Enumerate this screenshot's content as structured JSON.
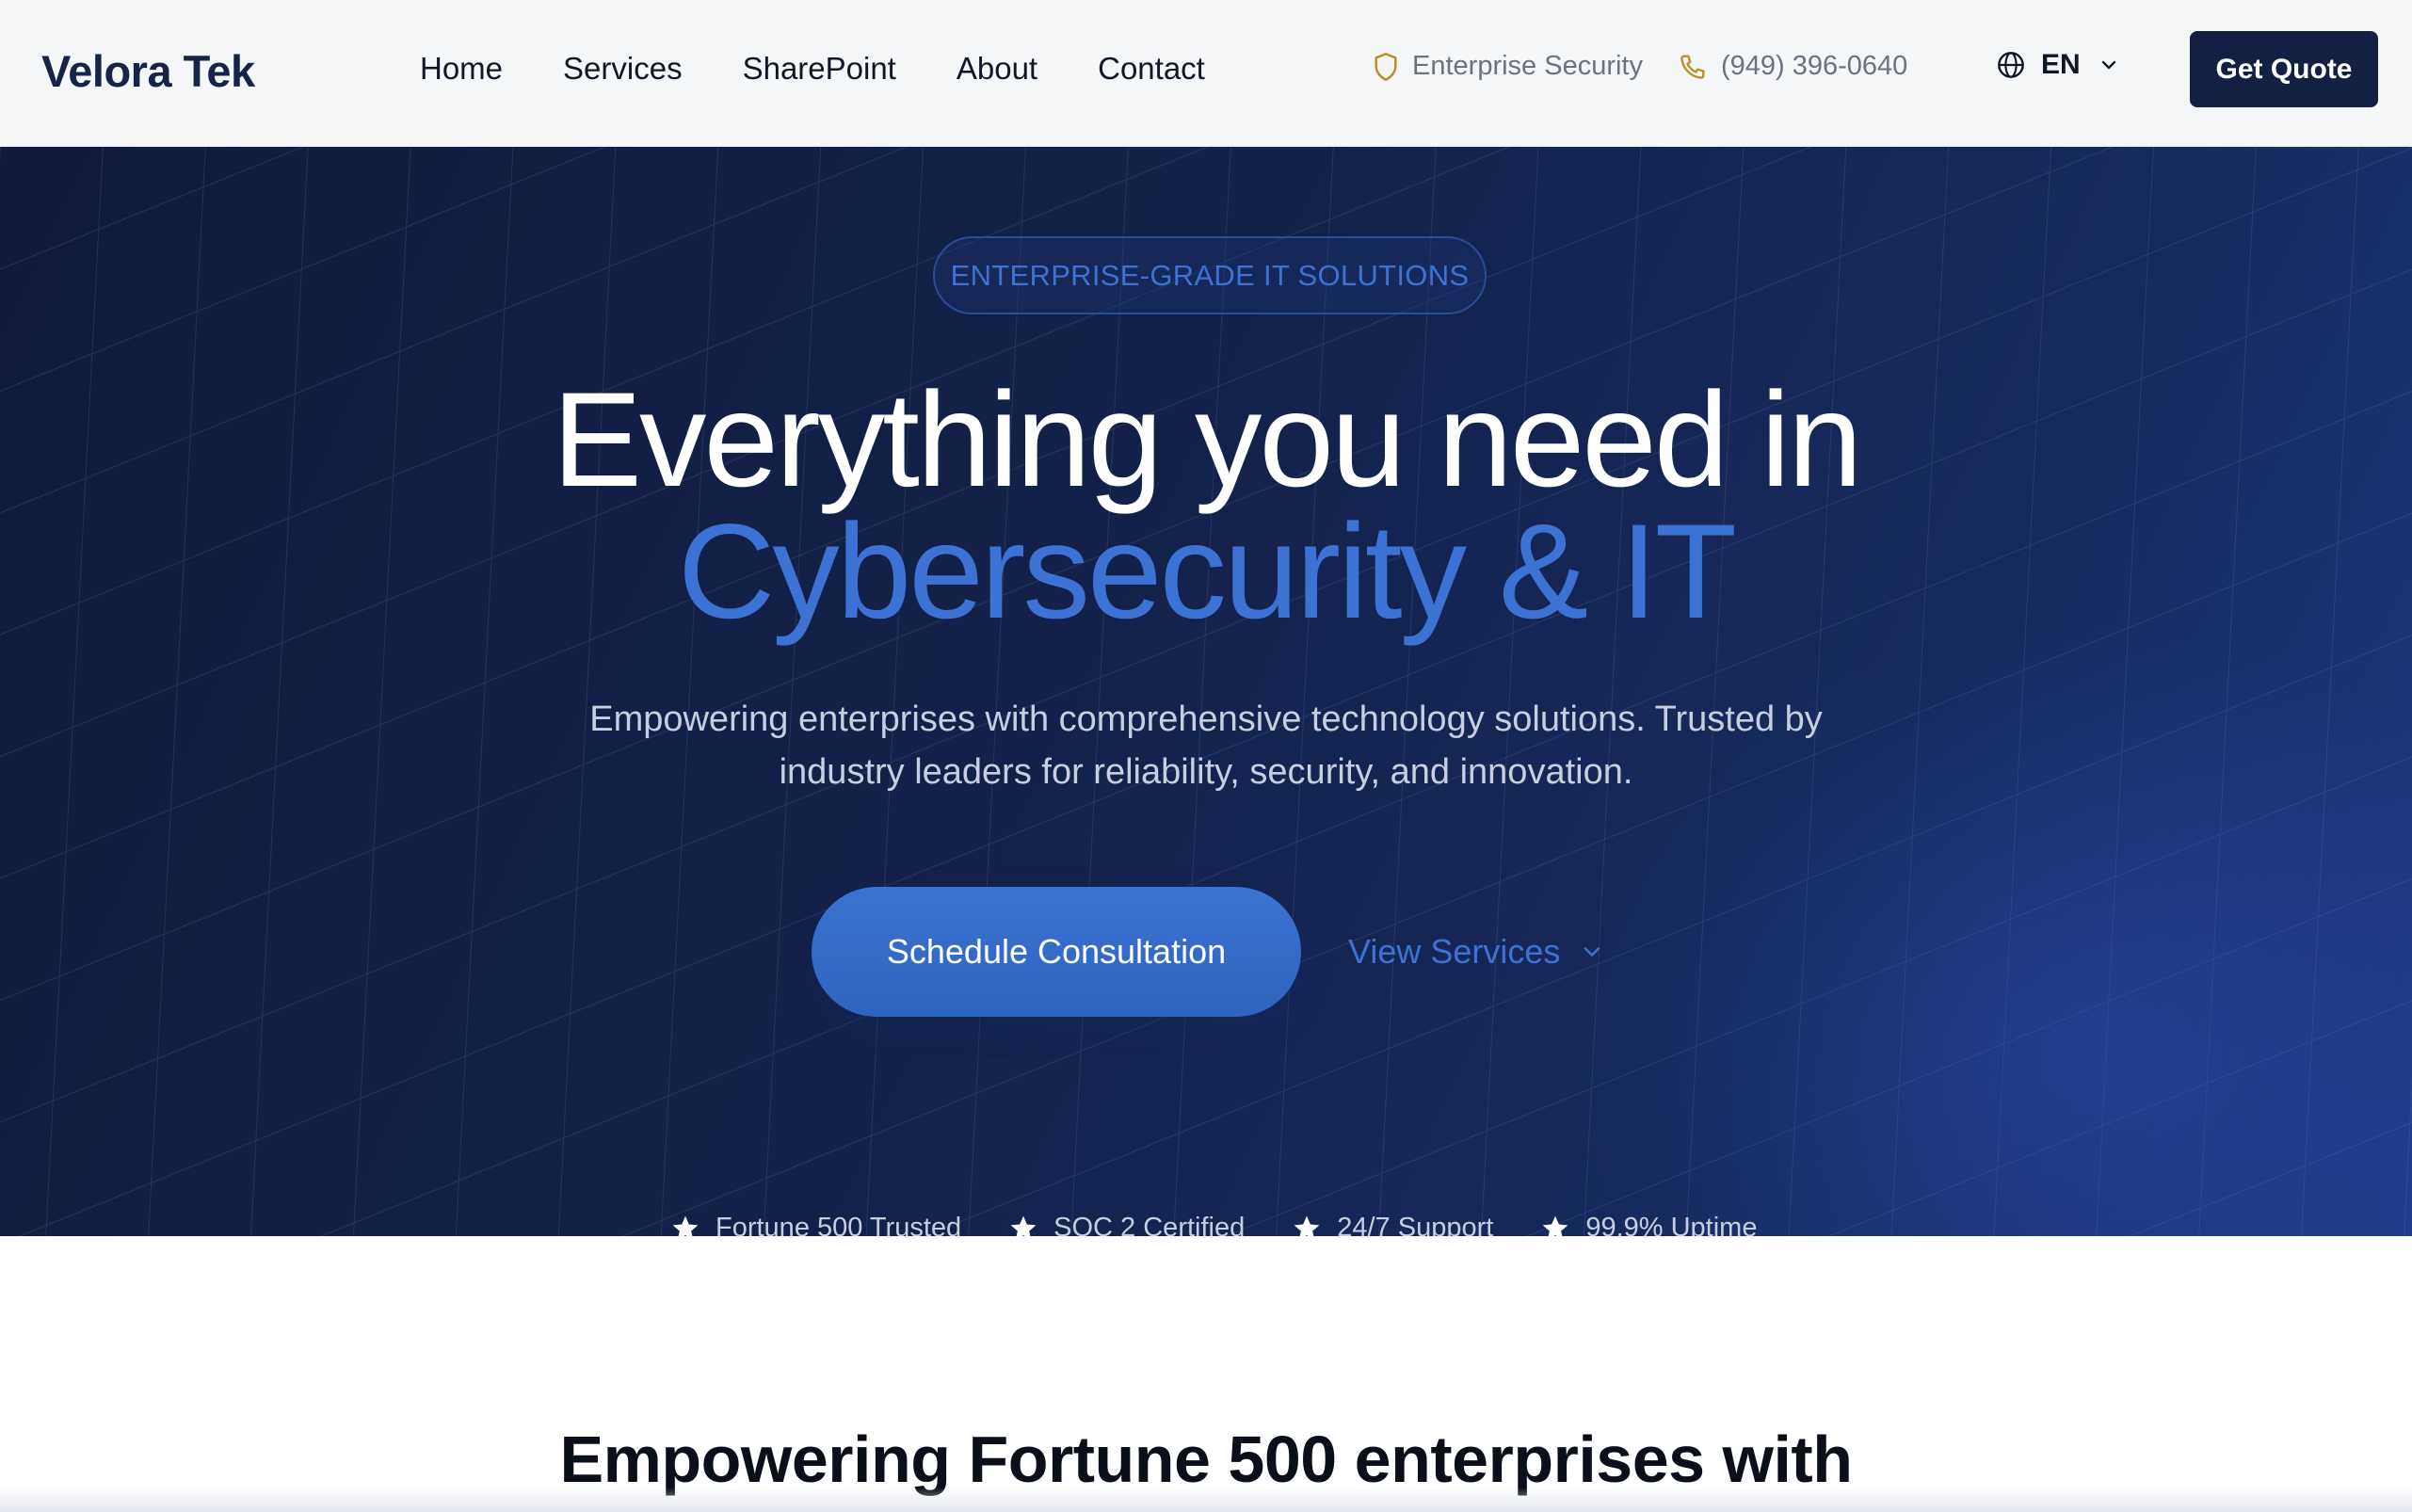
{
  "header": {
    "logo": "Velora Tek",
    "nav": [
      "Home",
      "Services",
      "SharePoint",
      "About",
      "Contact"
    ],
    "security_label": "Enterprise Security",
    "phone": "(949) 396-0640",
    "language": "EN",
    "quote_button": "Get Quote",
    "icons": {
      "security": "shield-icon",
      "phone": "phone-icon",
      "language": "globe-icon",
      "language_dropdown": "chevron-down-icon"
    },
    "accent_color": "#b8912e"
  },
  "hero": {
    "pill": "ENTERPRISE-GRADE IT SOLUTIONS",
    "headline_line1": "Everything you need in",
    "headline_line2": "Cybersecurity & IT",
    "subtext": "Empowering enterprises with comprehensive technology solutions. Trusted by industry leaders for reliability, security, and innovation.",
    "primary_cta": "Schedule Consultation",
    "secondary_cta": "View Services",
    "badges": [
      "Fortune 500 Trusted",
      "SOC 2 Certified",
      "24/7 Support",
      "99.9% Uptime"
    ],
    "colors": {
      "background": "#13214a",
      "accent": "#3b72d4"
    }
  },
  "section": {
    "title": "Empowering Fortune 500 enterprises with"
  }
}
